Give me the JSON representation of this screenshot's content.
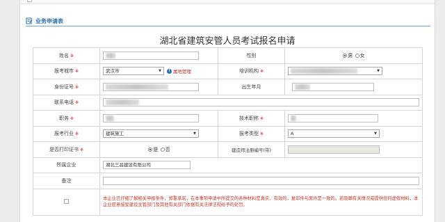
{
  "section_title": "业务申请表",
  "form_title": "湖北省建筑安管人员考试报名申请",
  "colors": {
    "accent": "#2a6db5",
    "required": "#e03b3b",
    "notice": "#c0392b"
  },
  "rows": {
    "name": {
      "label": "姓名"
    },
    "gender": {
      "label": "性别",
      "male": "男",
      "female": "女"
    },
    "city": {
      "label": "报考城市",
      "value": "武汉市",
      "link": "属地管理"
    },
    "institution": {
      "label": "培训机构"
    },
    "id_number": {
      "label": "身份证号"
    },
    "birth": {
      "label": "出生年月"
    },
    "phone": {
      "label": "联系电话"
    },
    "duty": {
      "label": "职务"
    },
    "title": {
      "label": "技术职称"
    },
    "industry": {
      "label": "报考行业",
      "value": "建筑施工"
    },
    "exam_type": {
      "label": "报考类型",
      "value": "A"
    },
    "print_cert": {
      "label": "是否打印证书",
      "yes": "是",
      "no": "否"
    },
    "reg_no": {
      "label": "建造师注册编号(带)"
    },
    "company": {
      "label": "所属企业",
      "value": "湖北三昌建设有限公司"
    },
    "remark": {
      "label": "备注"
    }
  },
  "notice_text": "本企业已仔细了解相关申报条件，郑重承诺，在本事项申请中所提交的各种材料是真实、有效的，复印件与原件是一致的。若隐瞒有关情况或提供任何虚假材料，本企业愿意接受建设主管部门及其他有关部门依据有关法律法规给予的处罚。"
}
